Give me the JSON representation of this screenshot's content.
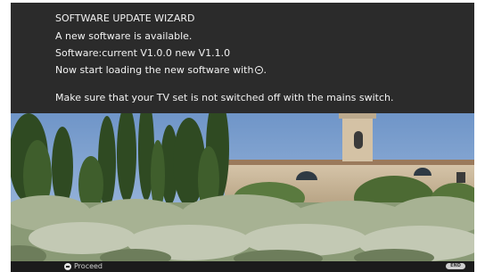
{
  "dialog": {
    "title": "SOFTWARE UPDATE WIZARD",
    "line1": "A new software is available.",
    "line2": "Software:current V1.0.0 new V1.1.0",
    "line3": "Now start loading the new software with",
    "line3_suffix": ".",
    "line4": "Make sure that your TV set is not switched off with the mains switch."
  },
  "footer": {
    "proceed_label": "Proceed",
    "end_label": "END"
  },
  "icons": {
    "ok": "ok-button-icon",
    "end": "end-button-icon"
  },
  "colors": {
    "panel": "#2b2b2b",
    "text": "#f2f2f2",
    "sky": "#7fa3cf"
  }
}
